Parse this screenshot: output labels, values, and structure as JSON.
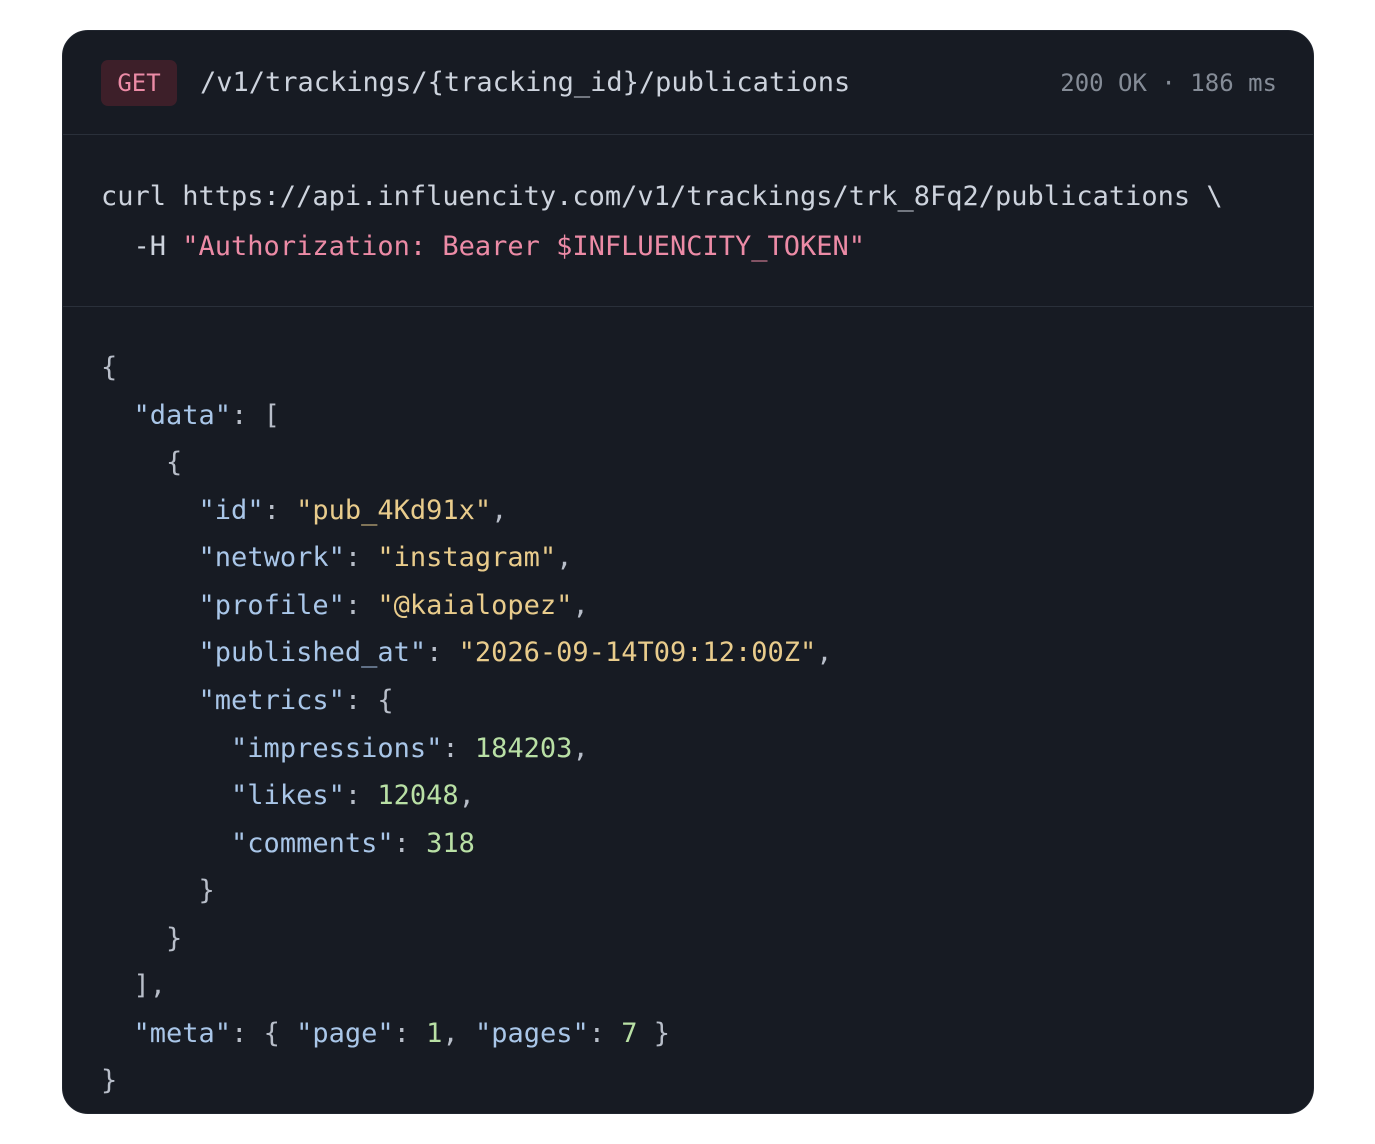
{
  "header": {
    "method": "GET",
    "endpoint": "/v1/trackings/{tracking_id}/publications",
    "status": "200 OK · 186 ms"
  },
  "request": {
    "line1": "curl https://api.influencity.com/v1/trackings/trk_8Fq2/publications \\",
    "line2_flag": "  -H ",
    "line2_header": "\"Authorization: Bearer $INFLUENCITY_TOKEN\""
  },
  "response": {
    "open_brace": "{",
    "data_key": "\"data\"",
    "item_open": "{",
    "id_key": "\"id\"",
    "id_value": "\"pub_4Kd91x\"",
    "network_key": "\"network\"",
    "network_value": "\"instagram\"",
    "profile_key": "\"profile\"",
    "profile_value": "\"@kaialopez\"",
    "published_key": "\"published_at\"",
    "published_value": "\"2026-09-14T09:12:00Z\"",
    "metrics_key": "\"metrics\"",
    "impressions_key": "\"impressions\"",
    "impressions_value": "184203",
    "likes_key": "\"likes\"",
    "likes_value": "12048",
    "comments_key": "\"comments\"",
    "comments_value": "318",
    "metrics_close": "}",
    "item_close": "}",
    "data_close": "],",
    "meta_key": "\"meta\"",
    "page_key": "\"page\"",
    "page_value": "1",
    "pages_key": "\"pages\"",
    "pages_value": "7",
    "close_brace": "}"
  },
  "colors": {
    "background": "#171b23",
    "method": "#ec8ba6",
    "key": "#a9c6e8",
    "string": "#e9cc8c",
    "number": "#b9e0a5"
  }
}
